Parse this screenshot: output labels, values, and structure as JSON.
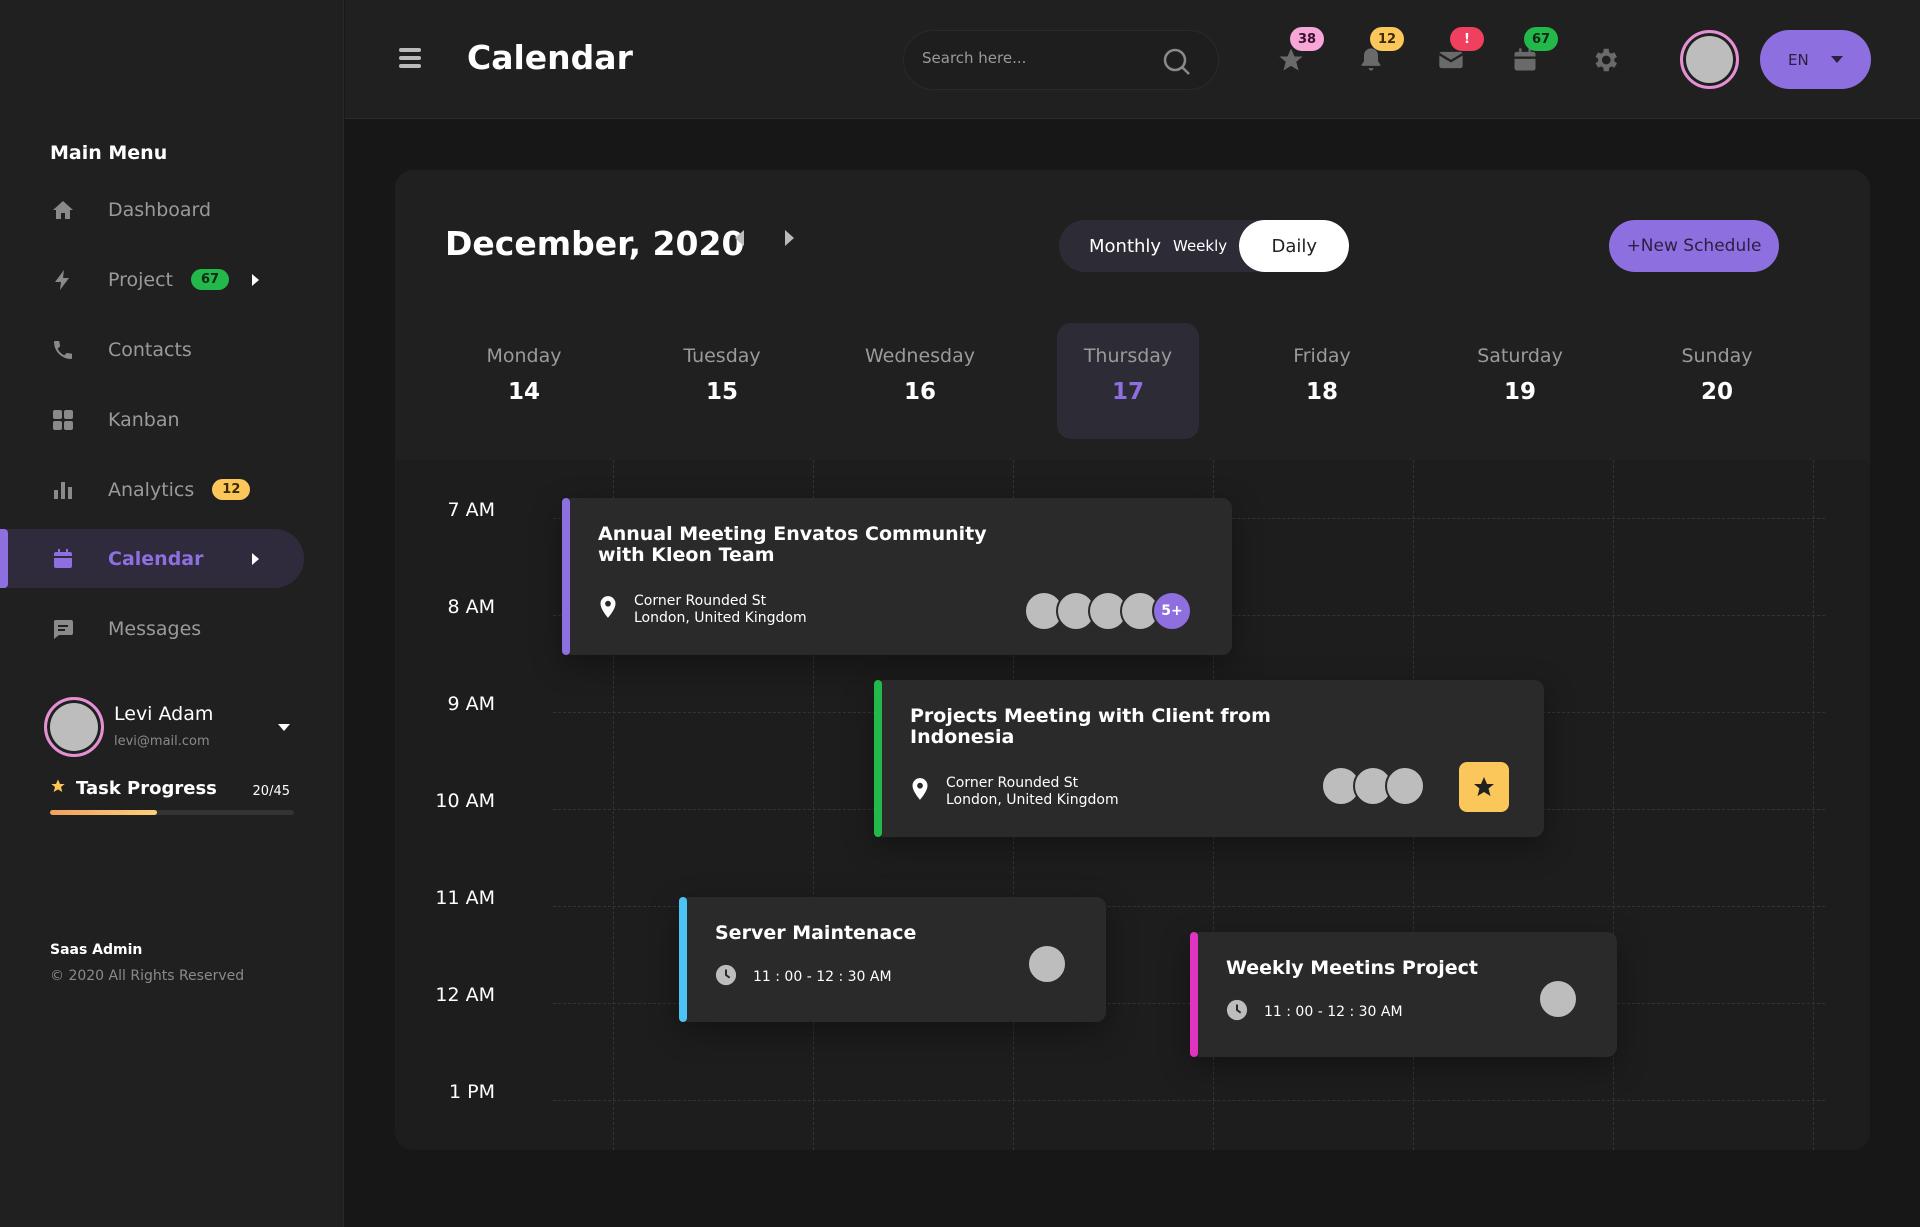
{
  "sidebar": {
    "menu_title": "Main Menu",
    "items": [
      {
        "label": "Dashboard",
        "icon": "home-icon"
      },
      {
        "label": "Project",
        "icon": "bolt-icon",
        "badge": "67"
      },
      {
        "label": "Contacts",
        "icon": "phone-icon"
      },
      {
        "label": "Kanban",
        "icon": "grid-icon"
      },
      {
        "label": "Analytics",
        "icon": "bar-chart-icon",
        "badge": "12"
      },
      {
        "label": "Calendar",
        "icon": "calendar-icon",
        "active": true
      },
      {
        "label": "Messages",
        "icon": "chat-icon"
      }
    ],
    "profile": {
      "name": "Levi Adam",
      "email": "levi@mail.com"
    },
    "task": {
      "label": "Task Progress",
      "count": "20/45",
      "progress": 0.44
    },
    "footer": {
      "brand": "Saas Admin",
      "copyright": "© 2020 All Rights Reserved"
    }
  },
  "header": {
    "title": "Calendar",
    "search_placeholder": "Search here...",
    "icons": [
      {
        "name": "star-icon",
        "badge": "38",
        "badge_color": "#f7a6d8"
      },
      {
        "name": "bell-icon",
        "badge": "12",
        "badge_color": "#fcc75a"
      },
      {
        "name": "mail-icon",
        "badge": "!",
        "badge_color": "#f04060"
      },
      {
        "name": "calendar-icon",
        "badge": "67",
        "badge_color": "#22b84a"
      },
      {
        "name": "gear-icon"
      }
    ],
    "language": "EN"
  },
  "calendar": {
    "month_label": "December, 2020",
    "views": {
      "monthly": "Monthly",
      "weekly": "Weekly",
      "daily": "Daily"
    },
    "new_button": "+New Schedule",
    "days": [
      {
        "name": "Monday",
        "num": "14"
      },
      {
        "name": "Tuesday",
        "num": "15"
      },
      {
        "name": "Wednesday",
        "num": "16"
      },
      {
        "name": "Thursday",
        "num": "17"
      },
      {
        "name": "Friday",
        "num": "18"
      },
      {
        "name": "Saturday",
        "num": "19"
      },
      {
        "name": "Sunday",
        "num": "20"
      }
    ],
    "times": [
      "7 AM",
      "8 AM",
      "9 AM",
      "10 AM",
      "11 AM",
      "12 AM",
      "1 PM"
    ],
    "events": [
      {
        "title_line1": "Annual Meeting Envatos Community",
        "title_line2": "with Kleon Team",
        "loc1": "Corner Rounded St",
        "loc2": "London, United Kingdom",
        "more": "5+",
        "color": "#8e6fe0"
      },
      {
        "title_line1": "Projects Meeting with Client from",
        "title_line2": "Indonesia",
        "loc1": "Corner Rounded St",
        "loc2": "London, United Kingdom",
        "color": "#22b84a"
      },
      {
        "title": "Server Maintenace",
        "time": "11 : 00 - 12 : 30 AM",
        "color": "#4cc3f5"
      },
      {
        "title": "Weekly Meetins Project",
        "time": "11 : 00 - 12 : 30 AM",
        "color": "#e034c0"
      }
    ]
  }
}
